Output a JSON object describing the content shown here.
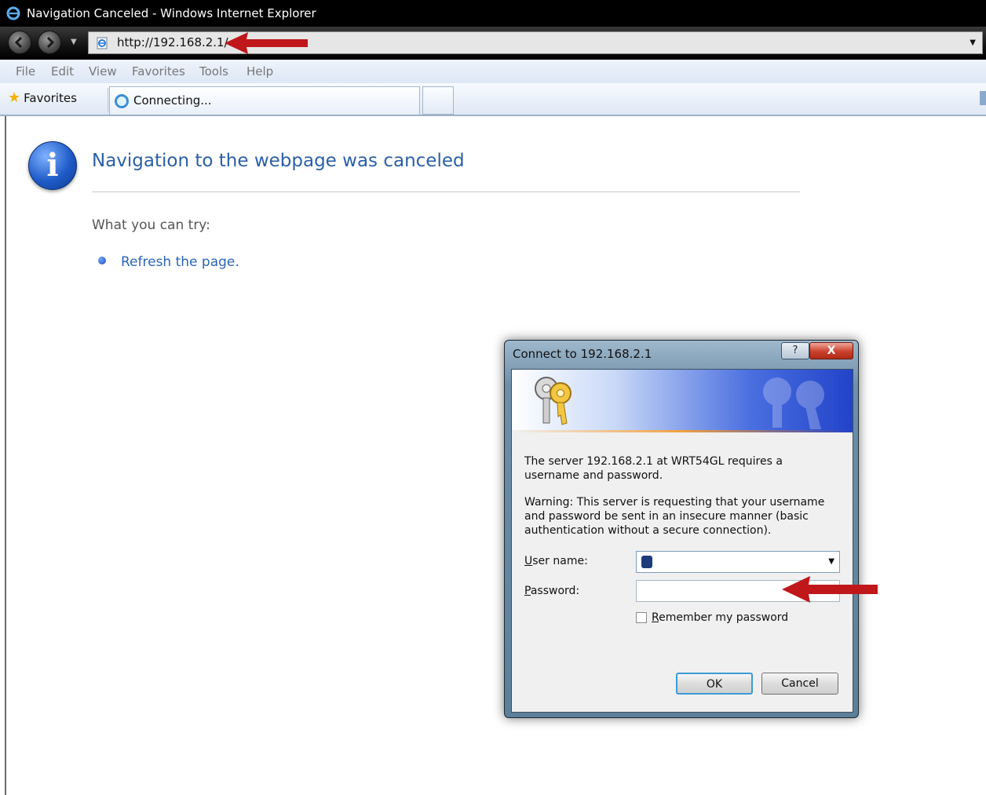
{
  "window": {
    "title": "Navigation Canceled - Windows Internet Explorer"
  },
  "address": {
    "url": "http://192.168.2.1/"
  },
  "menu": [
    "File",
    "Edit",
    "View",
    "Favorites",
    "Tools",
    "Help"
  ],
  "favorites_bar": {
    "favorites_label": "Favorites",
    "tab_label": "Connecting..."
  },
  "page": {
    "heading": "Navigation to the webpage was canceled",
    "try_label": "What you can try:",
    "refresh_link": "Refresh the page."
  },
  "dialog": {
    "title": "Connect to 192.168.2.1",
    "help_label": "?",
    "close_label": "X",
    "message": "The server 192.168.2.1 at WRT54GL requires a username and password.",
    "warning": "Warning: This server is requesting that your username and password be sent in an insecure manner (basic authentication without a secure connection).",
    "username_label_first": "U",
    "username_label_rest": "ser name:",
    "password_label_first": "P",
    "password_label_rest": "assword:",
    "username_value": "",
    "password_value": "",
    "remember_first": "R",
    "remember_rest": "emember my password",
    "remember_checked": false,
    "ok_label": "OK",
    "cancel_label": "Cancel"
  },
  "colors": {
    "arrow": "#c0171b",
    "link": "#2a65b5",
    "heading": "#2a5fa8"
  }
}
